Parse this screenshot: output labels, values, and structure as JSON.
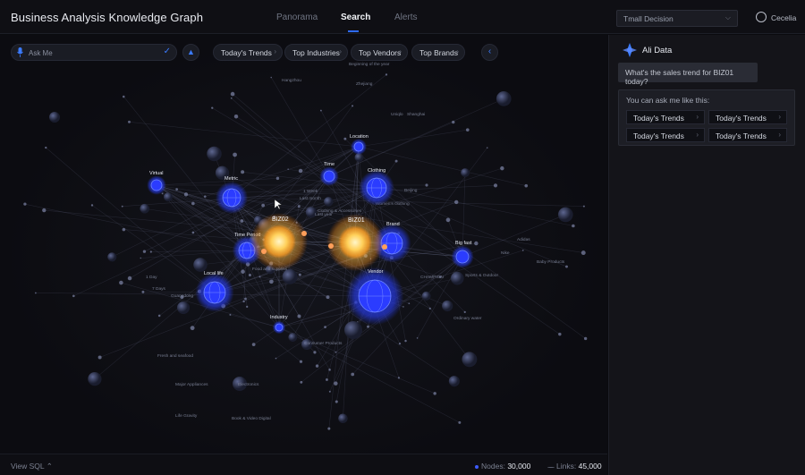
{
  "app": {
    "title": "Business Analysis Knowledge Graph"
  },
  "nav": {
    "tabs": [
      "Panorama",
      "Search",
      "Alerts"
    ],
    "active": "Search"
  },
  "top_select": {
    "value": "Tmall Decision"
  },
  "user": {
    "name": "Cecelia"
  },
  "search": {
    "placeholder": "Ask Me"
  },
  "chips": [
    "Today's Trends",
    "Top Industries",
    "Top Vendors",
    "Top Brands"
  ],
  "bottom": {
    "view_sql": "View SQL",
    "nodes_label": "Nodes:",
    "nodes_value": "30,000",
    "links_label": "Links:",
    "links_value": "45,000"
  },
  "graph": {
    "main_nodes": [
      "BIZ02",
      "BIZ01"
    ],
    "hub_nodes": [
      "Metric",
      "Virtual",
      "Time",
      "Location",
      "Clothing",
      "Brand",
      "Big fast",
      "Vendor",
      "Time Period",
      "Local life",
      "Industry"
    ],
    "minor_labels": [
      "Zhejiang",
      "Beginning of the year",
      "Women's clothing",
      "Electronics",
      "Food and supplies",
      "Consumer Products",
      "Hangzhou",
      "Last year",
      "Clothing & Accessories",
      "Sports & Outdoor",
      "Book & Video Digital",
      "Life Gravity",
      "Major Appliances",
      "Fresh and seafood",
      "Ordinary water",
      "Baby Products",
      "CHAMPION",
      "Nike",
      "Adidas",
      "Uniqlo",
      "Shanghai",
      "Beijing",
      "Guangdong",
      "1 Day",
      "7 Days",
      "1 Week",
      "Last month"
    ]
  },
  "panel": {
    "title": "Ali Data",
    "user_message": "What's the sales trend for BIZ01 today?",
    "suggest_intro": "You can ask me like this:",
    "suggestions": [
      "Today's Trends",
      "Today's Trends",
      "Today's Trends",
      "Today's Trends"
    ]
  },
  "colors": {
    "accent": "#2e6bff",
    "glow": "#ffb13a",
    "hub": "#3d5bff"
  }
}
